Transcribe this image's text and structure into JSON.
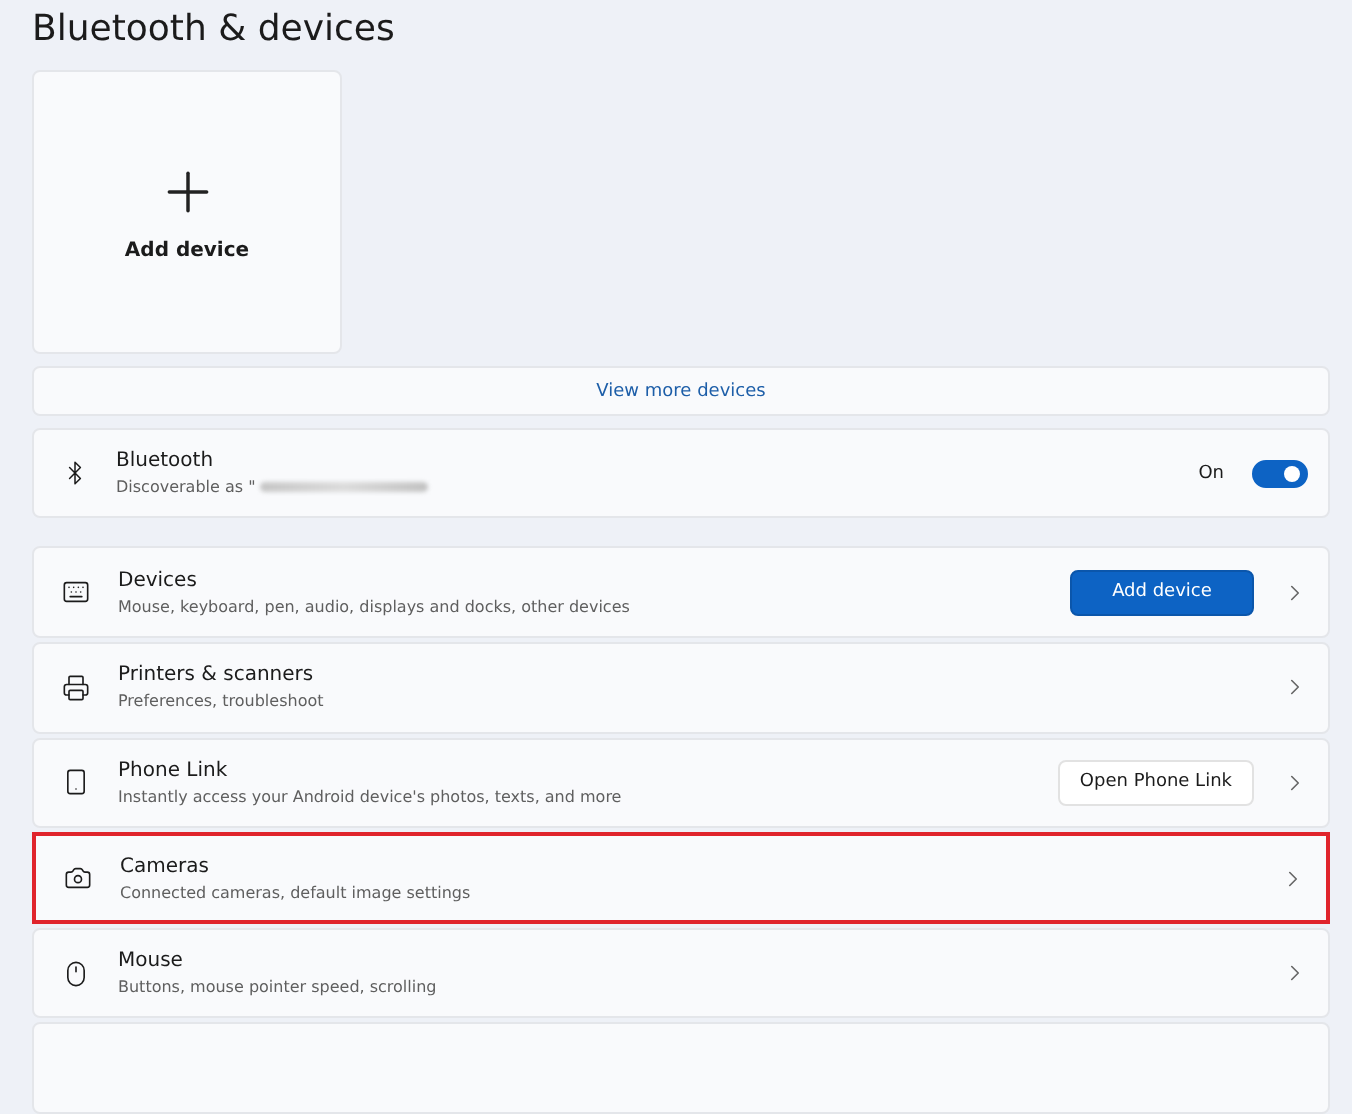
{
  "page_title": "Bluetooth & devices",
  "add_tile": {
    "label": "Add device"
  },
  "view_more": {
    "label": "View more devices"
  },
  "bluetooth": {
    "title": "Bluetooth",
    "subtitle": "Discoverable as \"",
    "state_label": "On",
    "on": true
  },
  "rows": [
    {
      "kind": "devices",
      "title": "Devices",
      "subtitle": "Mouse, keyboard, pen, audio, displays and docks, other devices",
      "button": {
        "label": "Add device",
        "kind": "primary"
      },
      "highlighted": false
    },
    {
      "kind": "printer",
      "title": "Printers & scanners",
      "subtitle": "Preferences, troubleshoot",
      "highlighted": false
    },
    {
      "kind": "phone",
      "title": "Phone Link",
      "subtitle": "Instantly access your Android device's photos, texts, and more",
      "button": {
        "label": "Open Phone Link",
        "kind": "secondary"
      },
      "highlighted": false
    },
    {
      "kind": "camera",
      "title": "Cameras",
      "subtitle": "Connected cameras, default image settings",
      "highlighted": true
    },
    {
      "kind": "mouse",
      "title": "Mouse",
      "subtitle": "Buttons, mouse pointer speed, scrolling",
      "highlighted": false
    }
  ]
}
